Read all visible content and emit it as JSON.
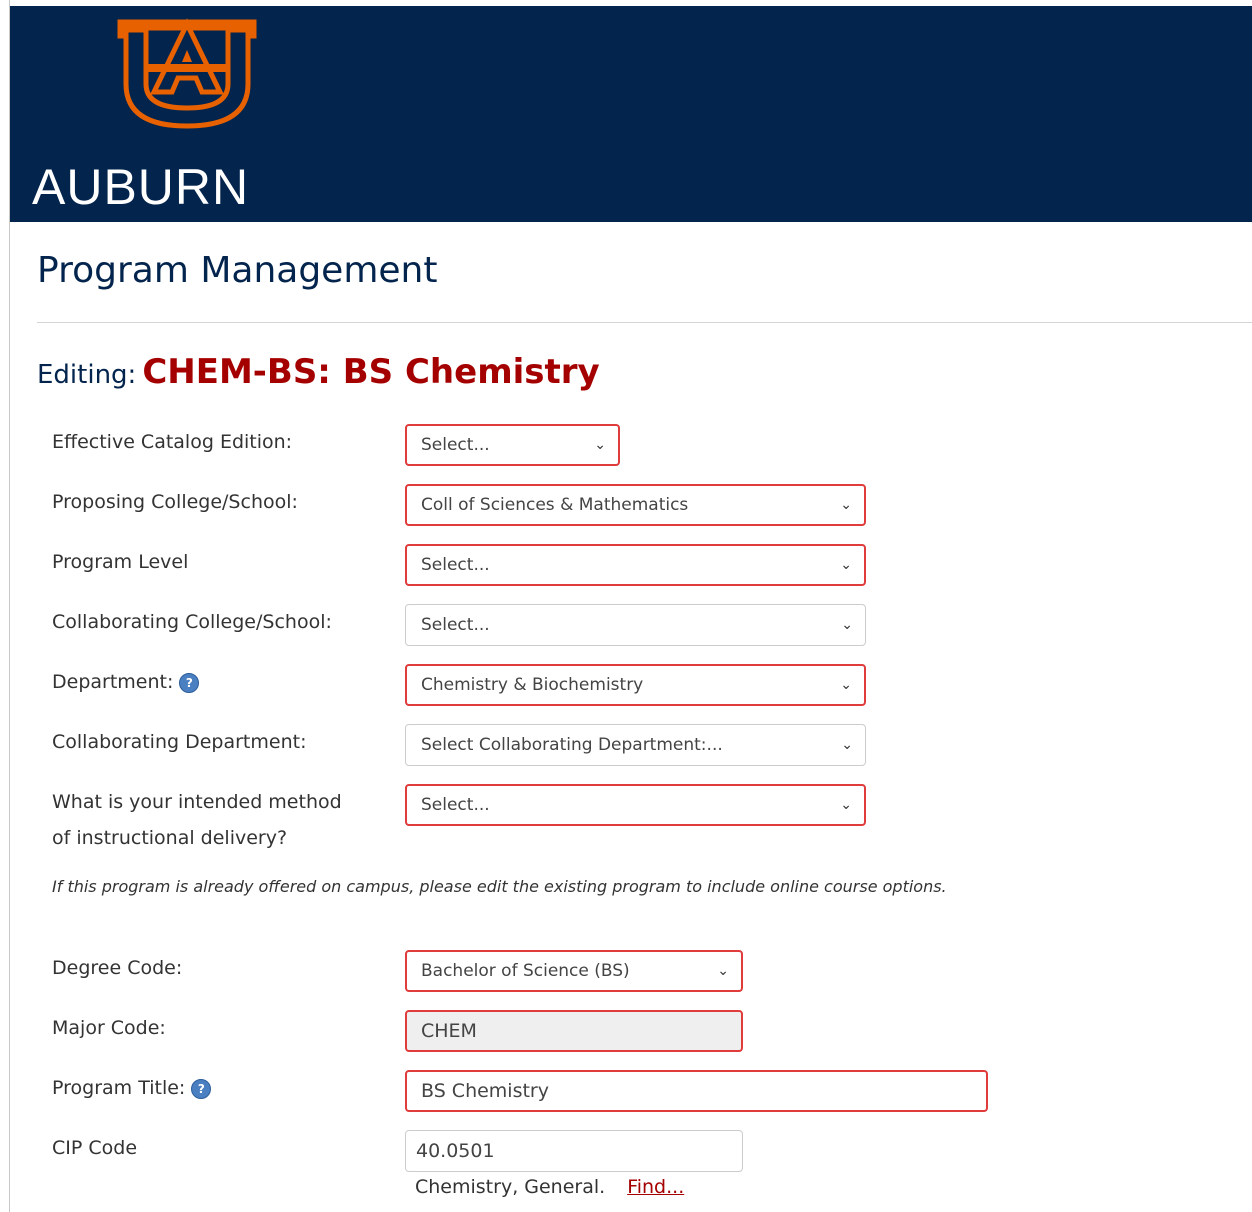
{
  "brand": {
    "wordmark": "AUBURN",
    "logo_icon": "au-logo-icon",
    "navy": "#03244d",
    "orange": "#e86100"
  },
  "page": {
    "title": "Program Management"
  },
  "editing": {
    "label": "Editing:",
    "program": "CHEM-BS: BS Chemistry"
  },
  "form": {
    "catalog_edition": {
      "label": "Effective Catalog Edition:",
      "value": "Select..."
    },
    "proposing_college": {
      "label": "Proposing College/School:",
      "value": "Coll of Sciences & Mathematics"
    },
    "program_level": {
      "label": "Program Level",
      "value": "Select..."
    },
    "collab_college": {
      "label": "Collaborating College/School:",
      "value": "Select..."
    },
    "department": {
      "label": "Department:",
      "value": "Chemistry & Biochemistry"
    },
    "collab_department": {
      "label": "Collaborating Department:",
      "value": "Select Collaborating Department:..."
    },
    "delivery_method": {
      "label_line1": "What is your intended method",
      "label_line2": "of instructional delivery?",
      "value": "Select..."
    },
    "online_note": "If this program is already offered on campus, please edit the existing program to include online course options.",
    "degree_code": {
      "label": "Degree Code:",
      "value": "Bachelor of Science (BS)"
    },
    "major_code": {
      "label": "Major Code:",
      "value": "CHEM"
    },
    "program_title": {
      "label": "Program Title:",
      "value": "BS Chemistry"
    },
    "cip_code": {
      "label": "CIP Code",
      "value": "40.0501",
      "description": "Chemistry, General.",
      "find_link": "Find..."
    }
  }
}
